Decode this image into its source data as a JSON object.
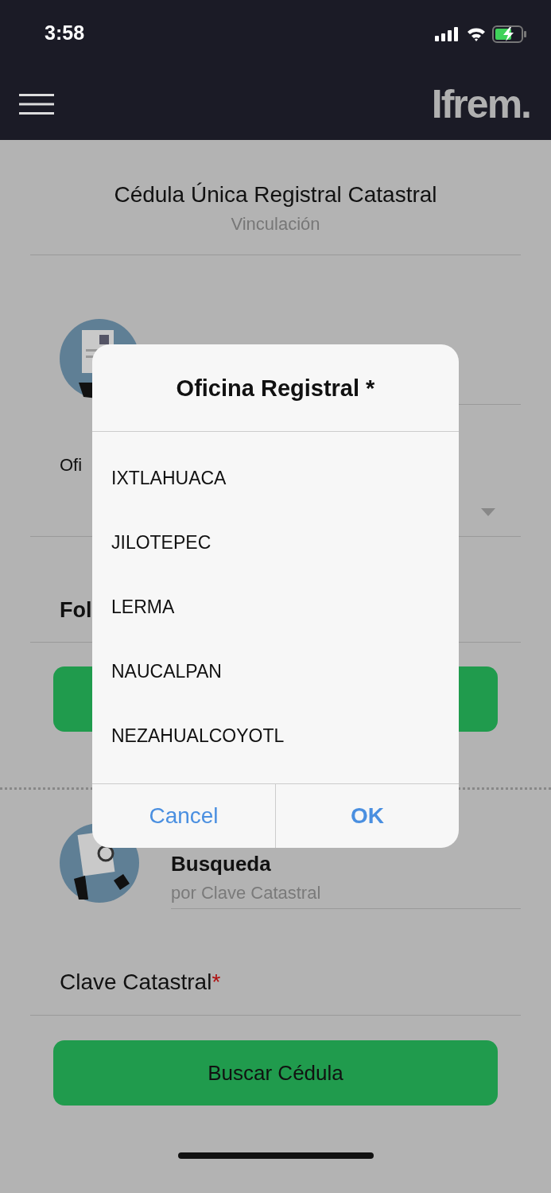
{
  "status_bar": {
    "time": "3:58"
  },
  "header": {
    "logo": "Ifrem."
  },
  "page": {
    "title": "Cédula Única Registral Catastral",
    "subtitle": "Vinculación"
  },
  "form_1": {
    "office_label": "Ofi",
    "folio_label": "Fol"
  },
  "form_2": {
    "title": "Busqueda",
    "subtitle": "por Clave Catastral",
    "field_label": "Clave Catastral",
    "required_mark": "*",
    "button": "Buscar Cédula"
  },
  "dialog": {
    "title": "Oficina Registral *",
    "options": [
      {
        "label": "IXTLAHUACA"
      },
      {
        "label": "JILOTEPEC"
      },
      {
        "label": "LERMA"
      },
      {
        "label": "NAUCALPAN"
      },
      {
        "label": "NEZAHUALCOYOTL"
      }
    ],
    "buttons": [
      {
        "label": "Cancel",
        "kind": "cancel"
      },
      {
        "label": "OK",
        "kind": "confirm"
      }
    ]
  }
}
